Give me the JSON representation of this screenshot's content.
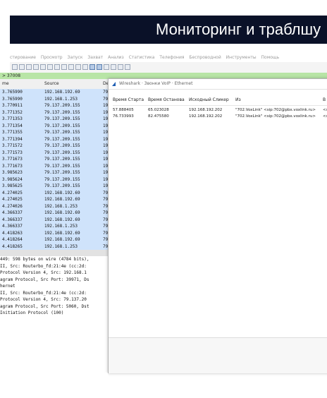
{
  "banner": {
    "title": "Мониторинг и траблшу"
  },
  "menu": [
    "стирование",
    "Просмотр",
    "Запуск",
    "Захват",
    "Анализ",
    "Статистика",
    "Телефония",
    "Беспроводной",
    "Инструменты",
    "Помощь"
  ],
  "filter": {
    "text": "> 37008"
  },
  "packet_list": {
    "columns": [
      "me",
      "Source",
      "De"
    ],
    "rows": [
      {
        "time": "3.765990",
        "source": "192.168.192.69",
        "dest": "79"
      },
      {
        "time": "3.765990",
        "source": "192.168.1.253",
        "dest": "79"
      },
      {
        "time": "3.770911",
        "source": "79.137.209.155",
        "dest": "19"
      },
      {
        "time": "3.771352",
        "source": "79.137.209.155",
        "dest": "19"
      },
      {
        "time": "3.771353",
        "source": "79.137.209.155",
        "dest": "19"
      },
      {
        "time": "3.771354",
        "source": "79.137.209.155",
        "dest": "19"
      },
      {
        "time": "3.771355",
        "source": "79.137.209.155",
        "dest": "19"
      },
      {
        "time": "3.771394",
        "source": "79.137.209.155",
        "dest": "19"
      },
      {
        "time": "3.771572",
        "source": "79.137.209.155",
        "dest": "19"
      },
      {
        "time": "3.771573",
        "source": "79.137.209.155",
        "dest": "19"
      },
      {
        "time": "3.771673",
        "source": "79.137.209.155",
        "dest": "19"
      },
      {
        "time": "3.771673",
        "source": "79.137.209.155",
        "dest": "19"
      },
      {
        "time": "3.985623",
        "source": "79.137.209.155",
        "dest": "19"
      },
      {
        "time": "3.985624",
        "source": "79.137.209.155",
        "dest": "19"
      },
      {
        "time": "3.985625",
        "source": "79.137.209.155",
        "dest": "19"
      },
      {
        "time": "4.274025",
        "source": "192.168.192.69",
        "dest": "79"
      },
      {
        "time": "4.274025",
        "source": "192.168.192.69",
        "dest": "79"
      },
      {
        "time": "4.274026",
        "source": "192.168.1.253",
        "dest": "79"
      },
      {
        "time": "4.366337",
        "source": "192.168.192.69",
        "dest": "79"
      },
      {
        "time": "4.366337",
        "source": "192.168.192.69",
        "dest": "79"
      },
      {
        "time": "4.366337",
        "source": "192.168.1.253",
        "dest": "79"
      },
      {
        "time": "4.418263",
        "source": "192.168.192.69",
        "dest": "79"
      },
      {
        "time": "4.418264",
        "source": "192.168.192.69",
        "dest": "79"
      },
      {
        "time": "4.418265",
        "source": "192.168.1.253",
        "dest": "79"
      }
    ]
  },
  "details": [
    "449: 598 bytes on wire (4784 bits),",
    " II, Src: Routerbo_fd:21:4e (cc:2d:",
    " Protocol Version 4, Src: 192.168.1",
    "agram Protocol, Src Port: 39971, Ds",
    "hernet",
    " II, Src: Routerbo_fd:21:4e (cc:2d:",
    " Protocol Version 4, Src: 79.137.20",
    "agram Protocol, Src Port: 5060, Dst",
    "Initiation Protocol (100)"
  ],
  "voip_dialog": {
    "title": "Wireshark · Звонки VoIP · Ethernet",
    "columns": [
      "Время Старта",
      "Время Останова",
      "Исходный Сликер",
      "Из",
      "В"
    ],
    "rows": [
      {
        "start": "57.888405",
        "stop": "65.023028",
        "initial_speaker": "192.168.192.202",
        "from": "\"702.VoxLink\" <sip:702@pbx.voxlink.ru>",
        "to": "<s"
      },
      {
        "start": "76.733993",
        "stop": "82.475580",
        "initial_speaker": "192.168.192.202",
        "from": "\"702.VoxLink\" <sip:702@pbx.voxlink.ru>",
        "to": "<s"
      }
    ]
  }
}
